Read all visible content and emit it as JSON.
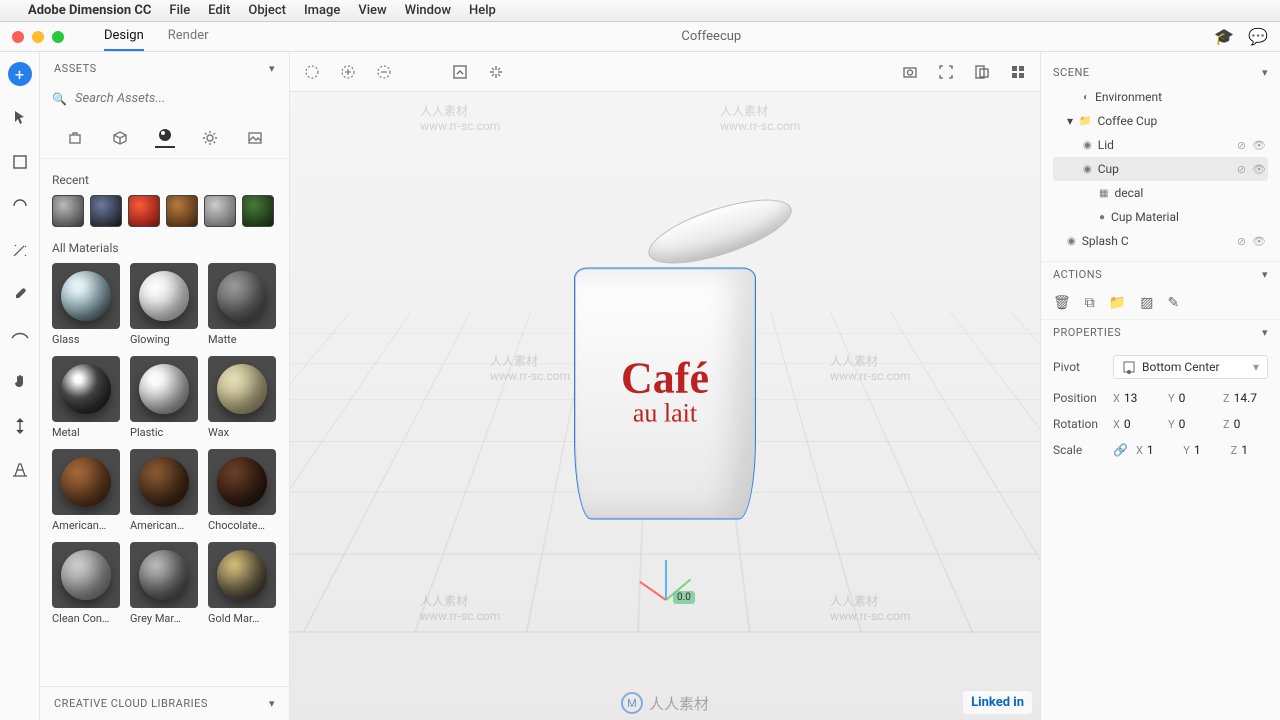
{
  "menubar": {
    "app": "Adobe Dimension CC",
    "items": [
      "File",
      "Edit",
      "Object",
      "Image",
      "View",
      "Window",
      "Help"
    ]
  },
  "titlebar": {
    "tabs": {
      "design": "Design",
      "render": "Render"
    },
    "doc": "Coffeecup"
  },
  "assets": {
    "title": "ASSETS",
    "search_placeholder": "Search Assets...",
    "recent_label": "Recent",
    "all_label": "All Materials",
    "materials": [
      {
        "label": "Glass",
        "bg": "radial-gradient(circle at 35% 30%, #e8f4f7 10%, #9fbfc9 55%, #3a4a50)"
      },
      {
        "label": "Glowing",
        "bg": "radial-gradient(circle at 50% 40%, #fff 25%, #f4f4f4 60%, #cfcfcf)"
      },
      {
        "label": "Matte",
        "bg": "radial-gradient(circle at 35% 30%, #9a9a9a, #4f4f4f)"
      },
      {
        "label": "Metal",
        "bg": "radial-gradient(circle at 35% 30%, #fff 8%, #555 40%, #111)"
      },
      {
        "label": "Plastic",
        "bg": "radial-gradient(circle at 35% 30%, #fff 12%, #d5d5d5 55%, #8f8f8f)"
      },
      {
        "label": "Wax",
        "bg": "radial-gradient(circle at 35% 30%, #e8e0b8, #b5ab77)"
      },
      {
        "label": "American…",
        "bg": "radial-gradient(circle at 35% 30%, #a66a3c, #4a2a14)"
      },
      {
        "label": "American…",
        "bg": "radial-gradient(circle at 35% 30%, #8a5a32, #2f1c0d)"
      },
      {
        "label": "Chocolate…",
        "bg": "radial-gradient(circle at 35% 30%, #6a4028, #20120a)"
      },
      {
        "label": "Clean Con…",
        "bg": "radial-gradient(circle at 35% 30%, #cfcfcf, #8a8a8a)"
      },
      {
        "label": "Grey Mar…",
        "bg": "radial-gradient(circle at 35% 30%, #bdbdbd, #444)"
      },
      {
        "label": "Gold Mar…",
        "bg": "radial-gradient(circle at 35% 30%, #d7c07a, #2a2a2a)"
      }
    ],
    "recent_colors": [
      "radial-gradient(circle at 35% 30%,#bbb,#333)",
      "radial-gradient(circle at 35% 30%,#6a7a9f,#111)",
      "radial-gradient(circle at 35% 30%,#ff5a3a,#6a0d0d)",
      "radial-gradient(circle at 35% 30%,#b57a3c,#3a1f0d)",
      "radial-gradient(circle at 35% 30%,#ccc,#555)",
      "radial-gradient(circle at 35% 30%,#4a7a3c,#0d1d0a)"
    ],
    "cc_label": "CREATIVE CLOUD LIBRARIES"
  },
  "scene": {
    "title": "SCENE",
    "items": [
      {
        "label": "Environment",
        "indent": 1,
        "icon": "env"
      },
      {
        "label": "Coffee Cup",
        "indent": 0,
        "icon": "folder",
        "open": true
      },
      {
        "label": "Lid",
        "indent": 1,
        "icon": "obj",
        "extras": true
      },
      {
        "label": "Cup",
        "indent": 1,
        "icon": "obj",
        "sel": true,
        "extras": true
      },
      {
        "label": "decal",
        "indent": 2,
        "icon": "decal"
      },
      {
        "label": "Cup Material",
        "indent": 2,
        "icon": "mat"
      },
      {
        "label": "Splash C",
        "indent": 0,
        "icon": "obj",
        "extras": true
      }
    ]
  },
  "actions": {
    "title": "ACTIONS"
  },
  "properties": {
    "title": "PROPERTIES",
    "pivot_label": "Pivot",
    "pivot_value": "Bottom Center",
    "position_label": "Position",
    "position": {
      "x": "13",
      "y": "0",
      "z": "14.7"
    },
    "rotation_label": "Rotation",
    "rotation": {
      "x": "0",
      "y": "0",
      "z": "0"
    },
    "scale_label": "Scale",
    "scale": {
      "x": "1",
      "y": "1",
      "z": "1"
    }
  },
  "cup": {
    "line1": "Café",
    "line2": "au lait"
  },
  "gizmo_value": "0.0",
  "watermark": {
    "cn": "人人素材",
    "url": "www.rr-sc.com"
  },
  "linkedin": "Linked in"
}
